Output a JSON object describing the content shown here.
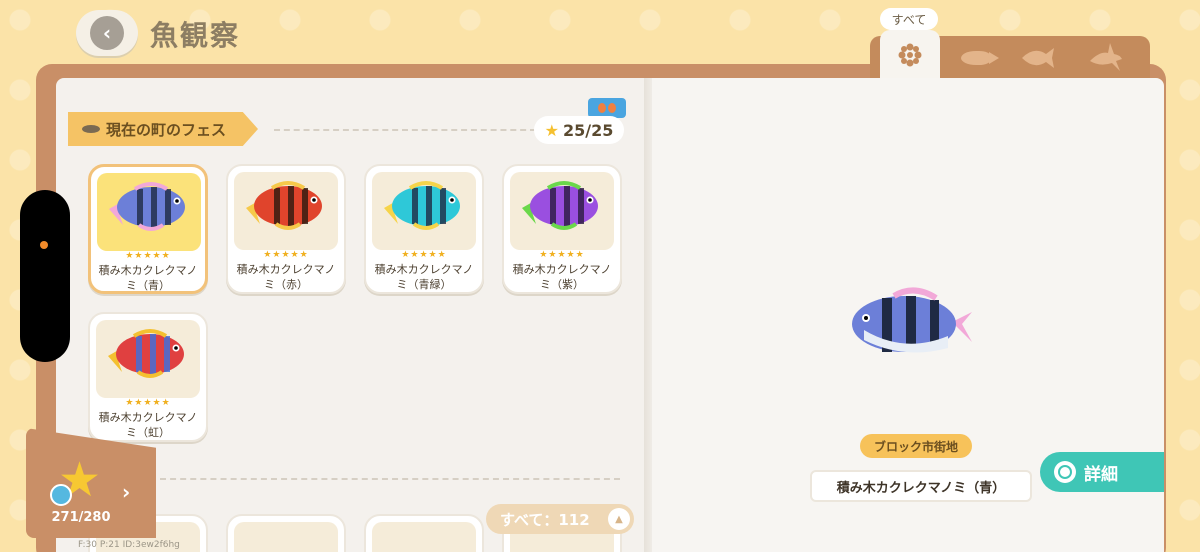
{
  "header": {
    "title": "魚観察",
    "back_icon": "chevron-left-icon"
  },
  "tabs": {
    "label": "すべて",
    "items": [
      {
        "name": "all",
        "icon": "flower-grid-icon",
        "active": true
      },
      {
        "name": "small-fish",
        "icon": "small-fish-icon",
        "active": false
      },
      {
        "name": "medium-fish",
        "icon": "medium-fish-icon",
        "active": false
      },
      {
        "name": "large-fish",
        "icon": "shark-icon",
        "active": false
      }
    ]
  },
  "section": {
    "title": "現在の町のフェス",
    "count": "25/25"
  },
  "cards": [
    {
      "name": "積み木カクレクマノミ（青）",
      "colors": [
        "#6c7fd8",
        "#f2a8d8",
        "#1f2a44"
      ],
      "stars": "★★★★★",
      "selected": true
    },
    {
      "name": "積み木カクレクマノミ（赤）",
      "colors": [
        "#e0442c",
        "#f6c94a",
        "#2a1a10"
      ],
      "stars": "★★★★★",
      "selected": false
    },
    {
      "name": "積み木カクレクマノミ（青緑）",
      "colors": [
        "#2ec8d8",
        "#f6d44a",
        "#1f2a44"
      ],
      "stars": "★★★★★",
      "selected": false
    },
    {
      "name": "積み木カクレクマノミ（紫）",
      "colors": [
        "#9a4fe0",
        "#6ad84a",
        "#2a1a40"
      ],
      "stars": "★★★★★",
      "selected": false
    },
    {
      "name": "積み木カクレクマノミ（虹）",
      "colors": [
        "#e04040",
        "#f4c030",
        "#3a70e0"
      ],
      "stars": "★★★★★",
      "selected": false
    }
  ],
  "all_count_label": "すべて：112",
  "collection": {
    "count": "271/280"
  },
  "debug": "F:30 P:21 ID:3ew2f6hg",
  "detail": {
    "location": "ブロック市街地",
    "fish_name": "積み木カクレクマノミ（青）",
    "detail_button": "詳細"
  },
  "colors": {
    "background": "#fbe3a8",
    "book_cover": "#c98f67",
    "accent_teal": "#3fc6b6",
    "ribbon": "#f5c365"
  }
}
